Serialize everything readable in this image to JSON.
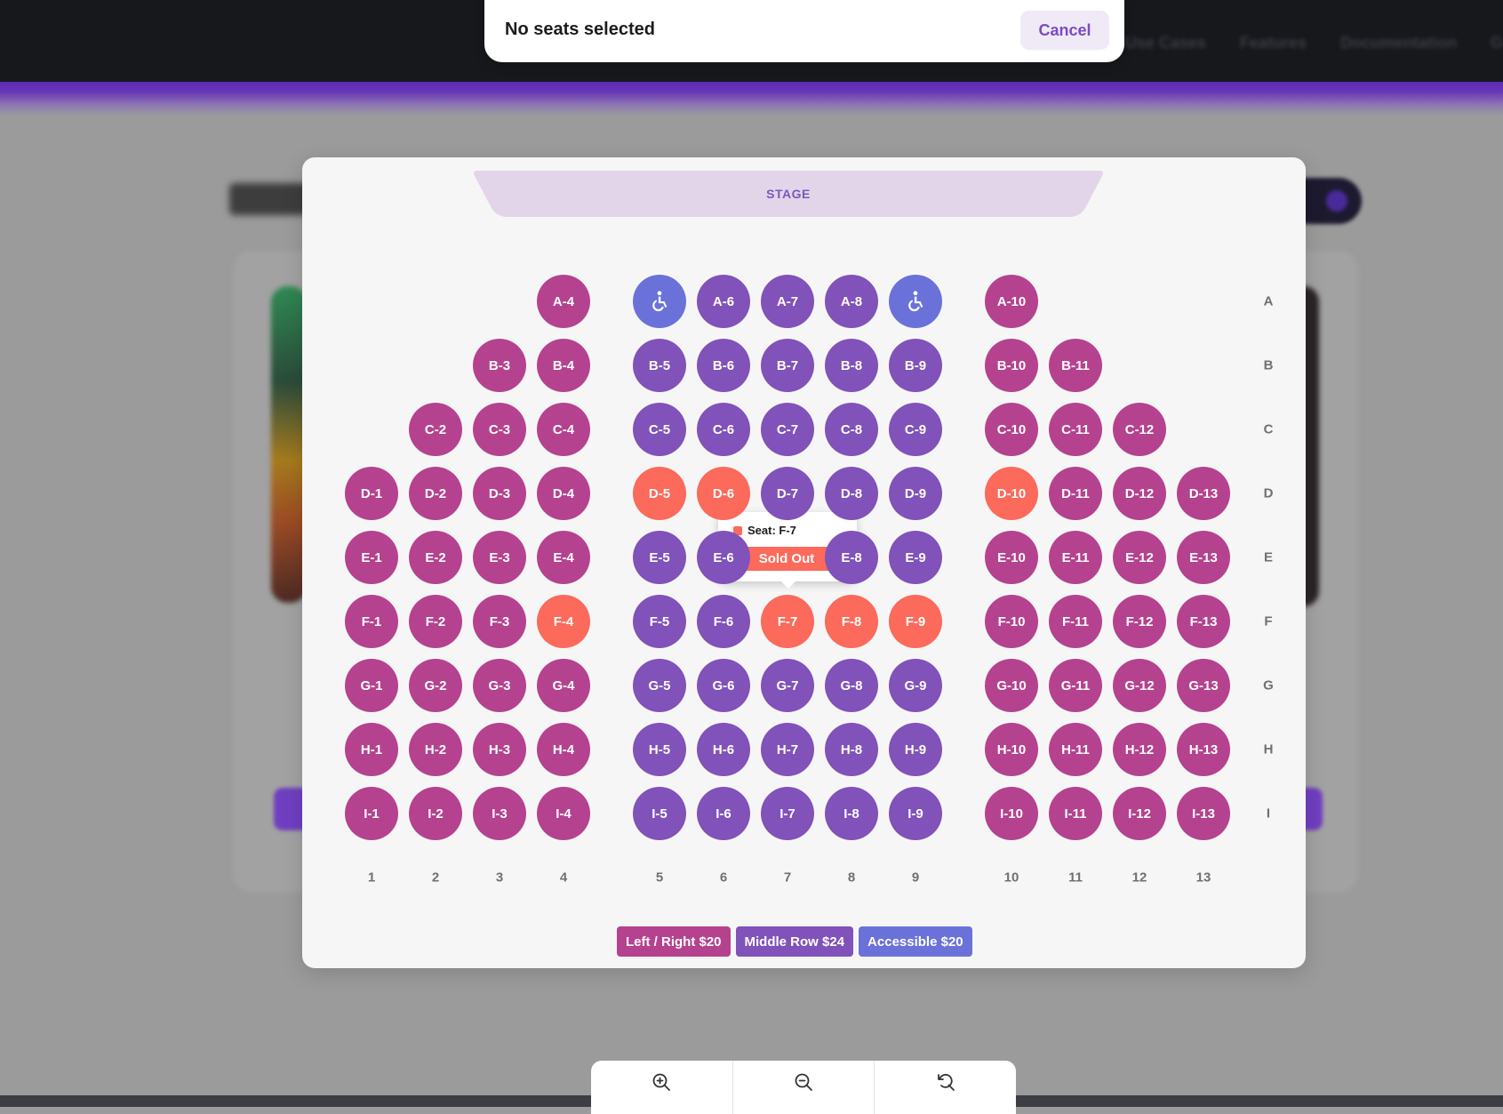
{
  "status": {
    "text": "No seats selected",
    "cancel_label": "Cancel"
  },
  "background_nav": [
    "Use Cases",
    "Features",
    "Documentation",
    "G"
  ],
  "stage": {
    "label": "STAGE"
  },
  "rows": [
    "A",
    "B",
    "C",
    "D",
    "E",
    "F",
    "G",
    "H",
    "I"
  ],
  "columns": [
    "1",
    "2",
    "3",
    "4",
    "5",
    "6",
    "7",
    "8",
    "9",
    "10",
    "11",
    "12",
    "13"
  ],
  "seat_states": {
    "side": "side",
    "middle": "middle",
    "accessible": "accessible",
    "sold": "sold"
  },
  "seats": [
    {
      "id": "A-4",
      "row": "A",
      "col": 4,
      "status": "side"
    },
    {
      "id": "A-5",
      "row": "A",
      "col": 5,
      "status": "accessible",
      "icon": "wheelchair-icon"
    },
    {
      "id": "A-6",
      "row": "A",
      "col": 6,
      "status": "middle"
    },
    {
      "id": "A-7",
      "row": "A",
      "col": 7,
      "status": "middle"
    },
    {
      "id": "A-8",
      "row": "A",
      "col": 8,
      "status": "middle"
    },
    {
      "id": "A-9",
      "row": "A",
      "col": 9,
      "status": "accessible",
      "icon": "wheelchair-icon"
    },
    {
      "id": "A-10",
      "row": "A",
      "col": 10,
      "status": "side"
    },
    {
      "id": "B-3",
      "row": "B",
      "col": 3,
      "status": "side"
    },
    {
      "id": "B-4",
      "row": "B",
      "col": 4,
      "status": "side"
    },
    {
      "id": "B-5",
      "row": "B",
      "col": 5,
      "status": "middle"
    },
    {
      "id": "B-6",
      "row": "B",
      "col": 6,
      "status": "middle"
    },
    {
      "id": "B-7",
      "row": "B",
      "col": 7,
      "status": "middle"
    },
    {
      "id": "B-8",
      "row": "B",
      "col": 8,
      "status": "middle"
    },
    {
      "id": "B-9",
      "row": "B",
      "col": 9,
      "status": "middle"
    },
    {
      "id": "B-10",
      "row": "B",
      "col": 10,
      "status": "side"
    },
    {
      "id": "B-11",
      "row": "B",
      "col": 11,
      "status": "side"
    },
    {
      "id": "C-2",
      "row": "C",
      "col": 2,
      "status": "side"
    },
    {
      "id": "C-3",
      "row": "C",
      "col": 3,
      "status": "side"
    },
    {
      "id": "C-4",
      "row": "C",
      "col": 4,
      "status": "side"
    },
    {
      "id": "C-5",
      "row": "C",
      "col": 5,
      "status": "middle"
    },
    {
      "id": "C-6",
      "row": "C",
      "col": 6,
      "status": "middle"
    },
    {
      "id": "C-7",
      "row": "C",
      "col": 7,
      "status": "middle"
    },
    {
      "id": "C-8",
      "row": "C",
      "col": 8,
      "status": "middle"
    },
    {
      "id": "C-9",
      "row": "C",
      "col": 9,
      "status": "middle"
    },
    {
      "id": "C-10",
      "row": "C",
      "col": 10,
      "status": "side"
    },
    {
      "id": "C-11",
      "row": "C",
      "col": 11,
      "status": "side"
    },
    {
      "id": "C-12",
      "row": "C",
      "col": 12,
      "status": "side"
    },
    {
      "id": "D-1",
      "row": "D",
      "col": 1,
      "status": "side"
    },
    {
      "id": "D-2",
      "row": "D",
      "col": 2,
      "status": "side"
    },
    {
      "id": "D-3",
      "row": "D",
      "col": 3,
      "status": "side"
    },
    {
      "id": "D-4",
      "row": "D",
      "col": 4,
      "status": "side"
    },
    {
      "id": "D-5",
      "row": "D",
      "col": 5,
      "status": "sold"
    },
    {
      "id": "D-6",
      "row": "D",
      "col": 6,
      "status": "sold"
    },
    {
      "id": "D-7",
      "row": "D",
      "col": 7,
      "status": "middle"
    },
    {
      "id": "D-8",
      "row": "D",
      "col": 8,
      "status": "middle"
    },
    {
      "id": "D-9",
      "row": "D",
      "col": 9,
      "status": "middle"
    },
    {
      "id": "D-10",
      "row": "D",
      "col": 10,
      "status": "sold"
    },
    {
      "id": "D-11",
      "row": "D",
      "col": 11,
      "status": "side"
    },
    {
      "id": "D-12",
      "row": "D",
      "col": 12,
      "status": "side"
    },
    {
      "id": "D-13",
      "row": "D",
      "col": 13,
      "status": "side"
    },
    {
      "id": "E-1",
      "row": "E",
      "col": 1,
      "status": "side"
    },
    {
      "id": "E-2",
      "row": "E",
      "col": 2,
      "status": "side"
    },
    {
      "id": "E-3",
      "row": "E",
      "col": 3,
      "status": "side"
    },
    {
      "id": "E-4",
      "row": "E",
      "col": 4,
      "status": "side"
    },
    {
      "id": "E-5",
      "row": "E",
      "col": 5,
      "status": "middle"
    },
    {
      "id": "E-6",
      "row": "E",
      "col": 6,
      "status": "middle"
    },
    {
      "id": "E-8",
      "row": "E",
      "col": 8,
      "status": "middle"
    },
    {
      "id": "E-9",
      "row": "E",
      "col": 9,
      "status": "middle"
    },
    {
      "id": "E-10",
      "row": "E",
      "col": 10,
      "status": "side"
    },
    {
      "id": "E-11",
      "row": "E",
      "col": 11,
      "status": "side"
    },
    {
      "id": "E-12",
      "row": "E",
      "col": 12,
      "status": "side"
    },
    {
      "id": "E-13",
      "row": "E",
      "col": 13,
      "status": "side"
    },
    {
      "id": "F-1",
      "row": "F",
      "col": 1,
      "status": "side"
    },
    {
      "id": "F-2",
      "row": "F",
      "col": 2,
      "status": "side"
    },
    {
      "id": "F-3",
      "row": "F",
      "col": 3,
      "status": "side"
    },
    {
      "id": "F-4",
      "row": "F",
      "col": 4,
      "status": "sold"
    },
    {
      "id": "F-5",
      "row": "F",
      "col": 5,
      "status": "middle"
    },
    {
      "id": "F-6",
      "row": "F",
      "col": 6,
      "status": "middle"
    },
    {
      "id": "F-7",
      "row": "F",
      "col": 7,
      "status": "sold"
    },
    {
      "id": "F-8",
      "row": "F",
      "col": 8,
      "status": "sold"
    },
    {
      "id": "F-9",
      "row": "F",
      "col": 9,
      "status": "sold"
    },
    {
      "id": "F-10",
      "row": "F",
      "col": 10,
      "status": "side"
    },
    {
      "id": "F-11",
      "row": "F",
      "col": 11,
      "status": "side"
    },
    {
      "id": "F-12",
      "row": "F",
      "col": 12,
      "status": "side"
    },
    {
      "id": "F-13",
      "row": "F",
      "col": 13,
      "status": "side"
    },
    {
      "id": "G-1",
      "row": "G",
      "col": 1,
      "status": "side"
    },
    {
      "id": "G-2",
      "row": "G",
      "col": 2,
      "status": "side"
    },
    {
      "id": "G-3",
      "row": "G",
      "col": 3,
      "status": "side"
    },
    {
      "id": "G-4",
      "row": "G",
      "col": 4,
      "status": "side"
    },
    {
      "id": "G-5",
      "row": "G",
      "col": 5,
      "status": "middle"
    },
    {
      "id": "G-6",
      "row": "G",
      "col": 6,
      "status": "middle"
    },
    {
      "id": "G-7",
      "row": "G",
      "col": 7,
      "status": "middle"
    },
    {
      "id": "G-8",
      "row": "G",
      "col": 8,
      "status": "middle"
    },
    {
      "id": "G-9",
      "row": "G",
      "col": 9,
      "status": "middle"
    },
    {
      "id": "G-10",
      "row": "G",
      "col": 10,
      "status": "side"
    },
    {
      "id": "G-11",
      "row": "G",
      "col": 11,
      "status": "side"
    },
    {
      "id": "G-12",
      "row": "G",
      "col": 12,
      "status": "side"
    },
    {
      "id": "G-13",
      "row": "G",
      "col": 13,
      "status": "side"
    },
    {
      "id": "H-1",
      "row": "H",
      "col": 1,
      "status": "side"
    },
    {
      "id": "H-2",
      "row": "H",
      "col": 2,
      "status": "side"
    },
    {
      "id": "H-3",
      "row": "H",
      "col": 3,
      "status": "side"
    },
    {
      "id": "H-4",
      "row": "H",
      "col": 4,
      "status": "side"
    },
    {
      "id": "H-5",
      "row": "H",
      "col": 5,
      "status": "middle"
    },
    {
      "id": "H-6",
      "row": "H",
      "col": 6,
      "status": "middle"
    },
    {
      "id": "H-7",
      "row": "H",
      "col": 7,
      "status": "middle"
    },
    {
      "id": "H-8",
      "row": "H",
      "col": 8,
      "status": "middle"
    },
    {
      "id": "H-9",
      "row": "H",
      "col": 9,
      "status": "middle"
    },
    {
      "id": "H-10",
      "row": "H",
      "col": 10,
      "status": "side"
    },
    {
      "id": "H-11",
      "row": "H",
      "col": 11,
      "status": "side"
    },
    {
      "id": "H-12",
      "row": "H",
      "col": 12,
      "status": "side"
    },
    {
      "id": "H-13",
      "row": "H",
      "col": 13,
      "status": "side"
    },
    {
      "id": "I-1",
      "row": "I",
      "col": 1,
      "status": "side"
    },
    {
      "id": "I-2",
      "row": "I",
      "col": 2,
      "status": "side"
    },
    {
      "id": "I-3",
      "row": "I",
      "col": 3,
      "status": "side"
    },
    {
      "id": "I-4",
      "row": "I",
      "col": 4,
      "status": "side"
    },
    {
      "id": "I-5",
      "row": "I",
      "col": 5,
      "status": "middle"
    },
    {
      "id": "I-6",
      "row": "I",
      "col": 6,
      "status": "middle"
    },
    {
      "id": "I-7",
      "row": "I",
      "col": 7,
      "status": "middle"
    },
    {
      "id": "I-8",
      "row": "I",
      "col": 8,
      "status": "middle"
    },
    {
      "id": "I-9",
      "row": "I",
      "col": 9,
      "status": "middle"
    },
    {
      "id": "I-10",
      "row": "I",
      "col": 10,
      "status": "side"
    },
    {
      "id": "I-11",
      "row": "I",
      "col": 11,
      "status": "side"
    },
    {
      "id": "I-12",
      "row": "I",
      "col": 12,
      "status": "side"
    },
    {
      "id": "I-13",
      "row": "I",
      "col": 13,
      "status": "side"
    }
  ],
  "tooltip": {
    "seat_text": "Seat: F-7",
    "status_text": "Sold Out",
    "status_color": "#fb6a5b"
  },
  "legend": [
    {
      "label": "Left / Right $20",
      "color": "#b5428f"
    },
    {
      "label": "Middle Row $24",
      "color": "#8152b9"
    },
    {
      "label": "Accessible $20",
      "color": "#6a72d9"
    }
  ],
  "zoom_controls": [
    {
      "name": "zoom-in-button",
      "icon": "zoom-in-icon"
    },
    {
      "name": "zoom-out-button",
      "icon": "zoom-out-icon"
    },
    {
      "name": "reset-zoom-button",
      "icon": "reset-icon"
    }
  ],
  "colors": {
    "side": "#b5428f",
    "middle": "#8152b9",
    "accessible": "#6a72d9",
    "sold": "#fb6a5b",
    "accent": "#7a4cc4"
  }
}
